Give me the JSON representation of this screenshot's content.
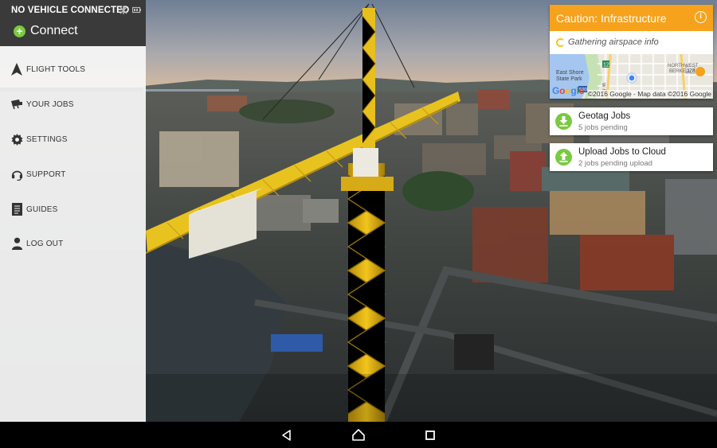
{
  "drawer": {
    "vehicle_status": "NO VEHICLE CONNECTED",
    "status_icons": [
      "satellite-off-icon",
      "battery-icon"
    ],
    "connect_label": "Connect",
    "menu": [
      {
        "label": "FLIGHT TOOLS",
        "icon": "navigation-arrow-icon"
      },
      {
        "label": "YOUR JOBS",
        "icon": "camera-icon"
      },
      {
        "label": "SETTINGS",
        "icon": "gear-icon"
      },
      {
        "label": "SUPPORT",
        "icon": "headset-icon"
      },
      {
        "label": "GUIDES",
        "icon": "document-icon"
      },
      {
        "label": "LOG OUT",
        "icon": "user-icon"
      }
    ]
  },
  "caution": {
    "title": "Caution: Infrastructure",
    "info_icon": "info-icon",
    "airspace_status": "Gathering airspace info"
  },
  "map": {
    "labels": {
      "east_shore": "East Shore",
      "state_park": "State Park",
      "northwest": "NORTHWEST",
      "berkeley": "BERKELEY",
      "route_12": "12",
      "route_123": "123",
      "route_580": "580",
      "street": "W Fr"
    },
    "google": "Google",
    "attribution": "©2016 Google - Map data ©2016 Google"
  },
  "jobs": [
    {
      "title": "Geotag Jobs",
      "subtitle": "5 jobs pending",
      "icon": "download-icon"
    },
    {
      "title": "Upload Jobs to Cloud",
      "subtitle": "2 jobs pending upload",
      "icon": "upload-icon"
    }
  ],
  "colors": {
    "accent_orange": "#f6a21d",
    "accent_green": "#7bc943",
    "drawer_header": "#3a3a3a"
  },
  "navbar": [
    "back-icon",
    "home-icon",
    "recents-icon"
  ]
}
